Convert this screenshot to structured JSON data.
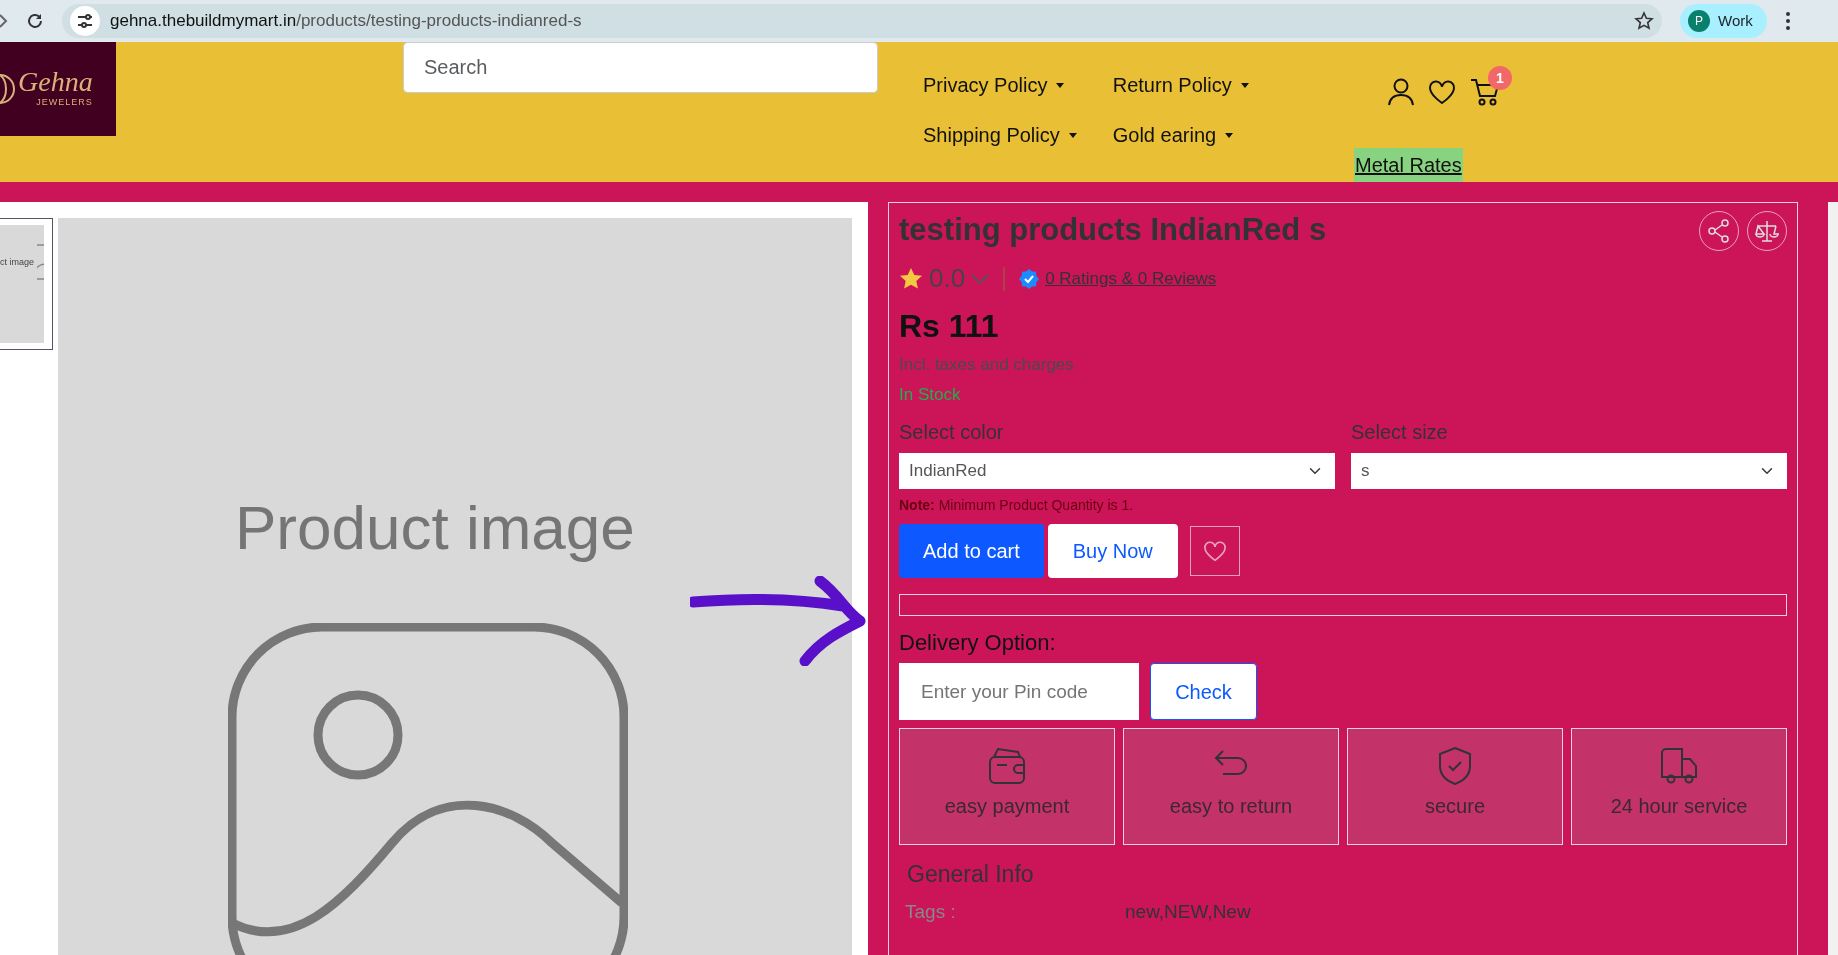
{
  "browser": {
    "url_host": "gehna.thebuildmymart.in",
    "url_path": "/products/testing-products-indianred-s",
    "profile_initial": "P",
    "profile_label": "Work"
  },
  "header": {
    "logo_text": "Gehna",
    "logo_subtext": "JEWELERS",
    "search": {
      "placeholder": "Search"
    },
    "nav": [
      {
        "label": "Privacy Policy"
      },
      {
        "label": "Return Policy"
      },
      {
        "label": "Shipping Policy"
      },
      {
        "label": "Gold earing"
      }
    ],
    "cart_count": "1",
    "metal_rates": "Metal Rates"
  },
  "gallery": {
    "thumbnail_text": "ct image",
    "image_text": "Product image"
  },
  "product": {
    "title": "testing products IndianRed s",
    "rating": "0.0",
    "ratings_link": "0 Ratings  & 0 Reviews",
    "price": "Rs 111",
    "tax_note": "Incl. taxes and charges",
    "stock": "In Stock",
    "color_label": "Select color",
    "color_value": "IndianRed",
    "size_label": "Select size",
    "size_value": "s",
    "note": "**Note:** Minimum Product Quantity is 1."
  },
  "buttons": {
    "add_to_cart": "Add to cart",
    "buy_now": "Buy Now"
  },
  "delivery": {
    "label": "Delivery Option:",
    "placeholder": "Enter your Pin code",
    "button": "Check"
  },
  "features": [
    {
      "kind": "wallet",
      "label": "easy payment"
    },
    {
      "kind": "return",
      "label": "easy to return"
    },
    {
      "kind": "shield",
      "label": "secure"
    },
    {
      "kind": "truck",
      "label": "24 hour service"
    }
  ],
  "general_info": {
    "title": "General Info",
    "tags_label": "Tags :",
    "tags_value": "new,NEW,New"
  }
}
